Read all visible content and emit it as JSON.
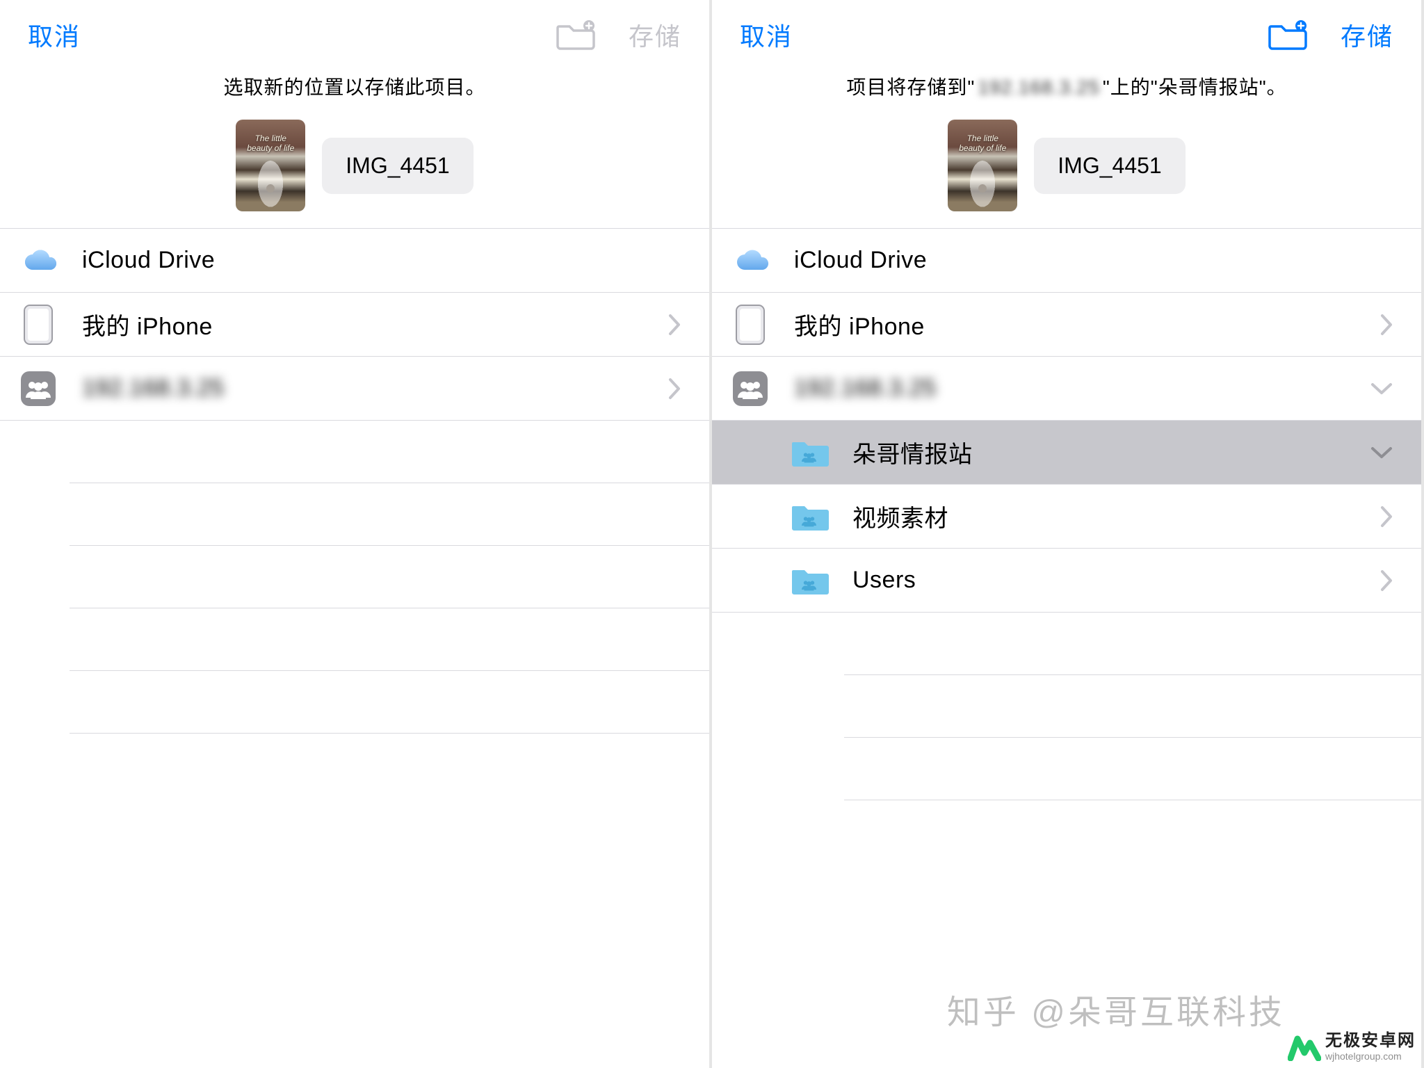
{
  "left": {
    "nav": {
      "cancel": "取消",
      "save": "存储"
    },
    "subtitle": "选取新的位置以存储此项目。",
    "filename": "IMG_4451",
    "thumb_caption": "The little beauty of life",
    "rows": [
      {
        "name": "icloud",
        "label": "iCloud Drive",
        "icon": "cloud",
        "chevron": "none"
      },
      {
        "name": "iphone",
        "label": "我的 iPhone",
        "icon": "device",
        "chevron": "right"
      },
      {
        "name": "server",
        "label": "192.168.3.25",
        "icon": "people",
        "chevron": "right",
        "blurred": true
      }
    ],
    "folder_add_active": false
  },
  "right": {
    "nav": {
      "cancel": "取消",
      "save": "存储"
    },
    "subtitle_prefix": "项目将存储到\"",
    "subtitle_mid": "192.168.3.25",
    "subtitle_suffix": "\"上的\"朵哥情报站\"。",
    "filename": "IMG_4451",
    "thumb_caption": "The little beauty of life",
    "rows": [
      {
        "name": "icloud",
        "label": "iCloud Drive",
        "icon": "cloud",
        "chevron": "none"
      },
      {
        "name": "iphone",
        "label": "我的 iPhone",
        "icon": "device",
        "chevron": "right"
      },
      {
        "name": "server",
        "label": "192.168.3.25",
        "icon": "people",
        "chevron": "down",
        "blurred": true
      }
    ],
    "subrows": [
      {
        "name": "folder-duoge",
        "label": "朵哥情报站",
        "chevron": "down",
        "selected": true
      },
      {
        "name": "folder-video",
        "label": "视频素材",
        "chevron": "right"
      },
      {
        "name": "folder-users",
        "label": "Users",
        "chevron": "right"
      }
    ],
    "folder_add_active": true
  },
  "watermark": {
    "center": "知乎 @朵哥互联科技",
    "corner_l1": "无极安卓网",
    "corner_l2": "wjhotelgroup.com"
  }
}
